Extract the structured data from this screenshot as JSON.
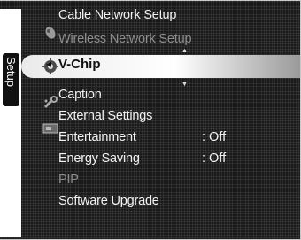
{
  "side_tab": {
    "label": "Setup"
  },
  "menu": {
    "items": [
      {
        "label": "Cable Network Setup",
        "state": "enabled"
      },
      {
        "label": "Wireless Network Setup",
        "state": "disabled"
      },
      {
        "label": "V-Chip",
        "state": "selected"
      },
      {
        "label": "Caption",
        "state": "enabled"
      },
      {
        "label": "External Settings",
        "state": "enabled"
      },
      {
        "label": "Entertainment",
        "value": ": Off",
        "state": "enabled"
      },
      {
        "label": "Energy Saving",
        "value": ": Off",
        "state": "enabled"
      },
      {
        "label": "PIP",
        "state": "disabled"
      },
      {
        "label": "Software Upgrade",
        "state": "enabled"
      }
    ],
    "selected_marker": "◂",
    "scroll_up": "▲",
    "scroll_down": "▼"
  },
  "icons": [
    "satellite-icon",
    "gear-icon",
    "wrench-icon",
    "input-icon"
  ],
  "colors": {
    "background": "#1a1a1a",
    "text": "#f2f2f2",
    "disabled_text": "#8d8d8d",
    "highlight": "#ffffff"
  }
}
